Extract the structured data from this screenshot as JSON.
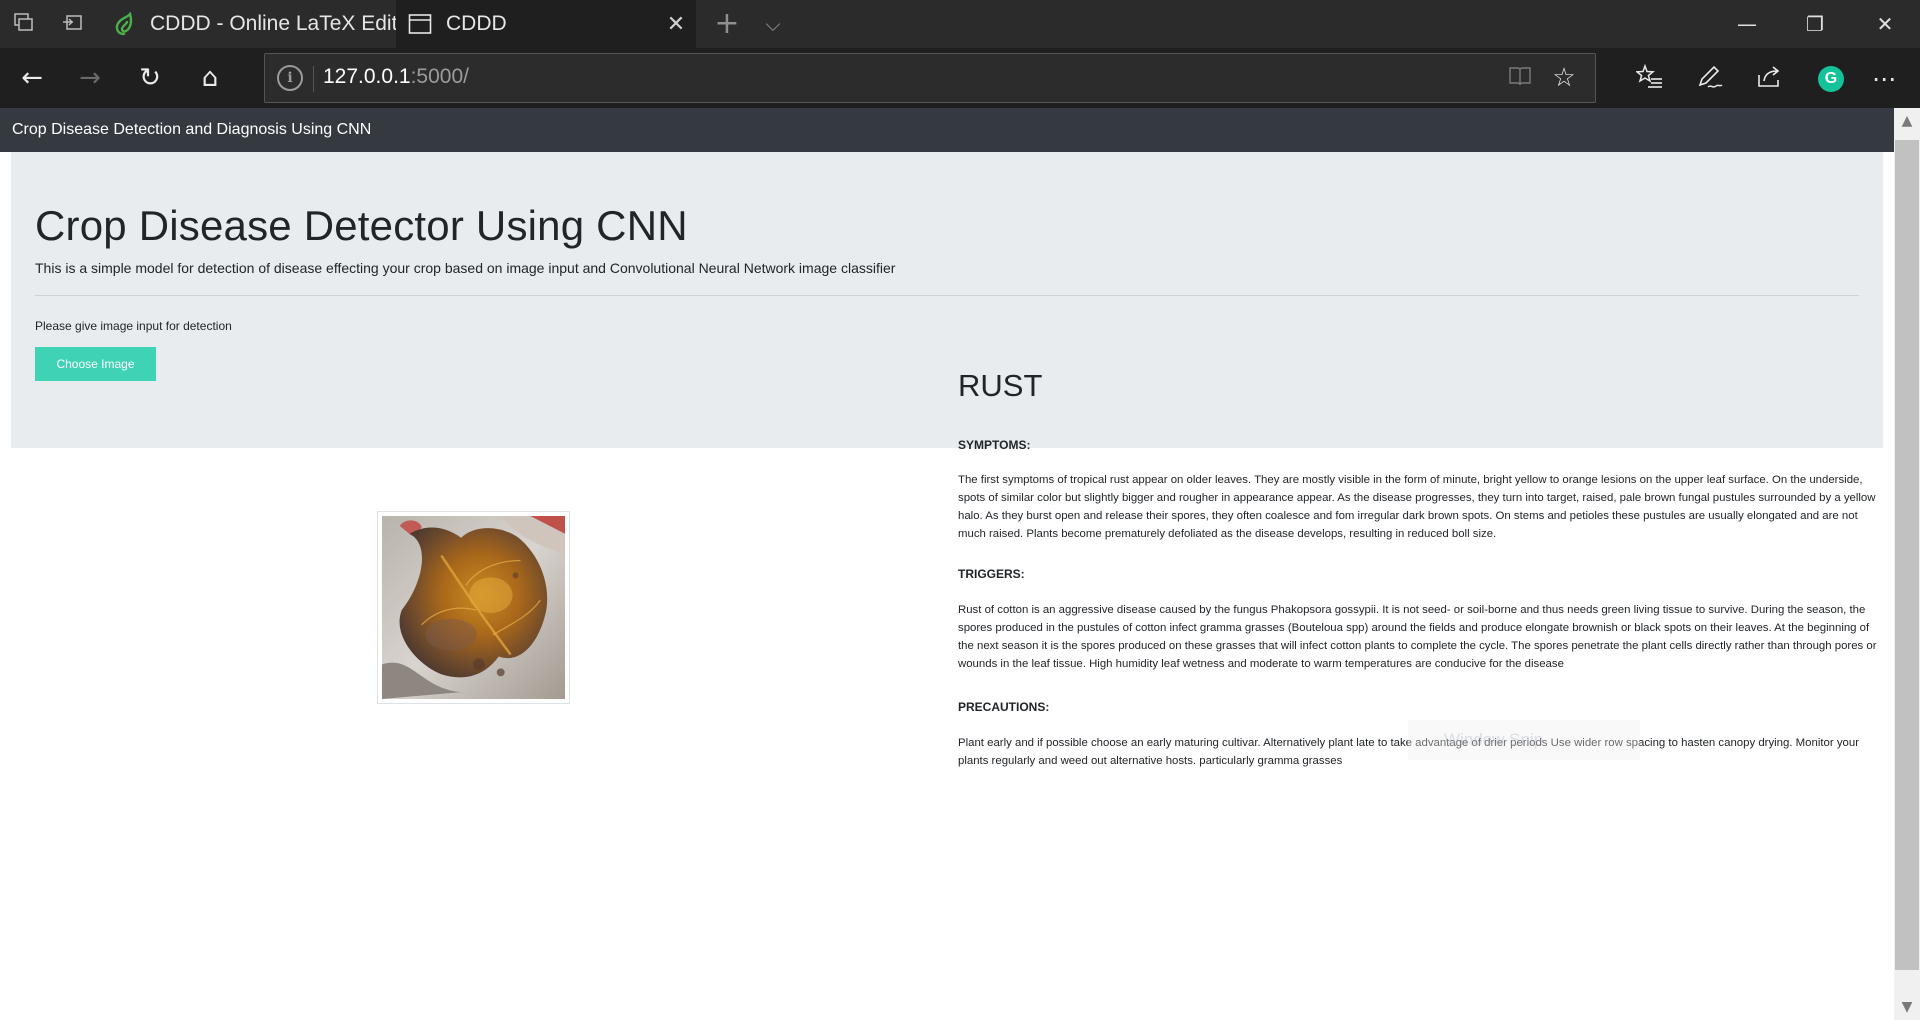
{
  "browser": {
    "tabs": [
      {
        "label": "CDDD - Online LaTeX Editor",
        "active": false
      },
      {
        "label": "CDDD",
        "active": true
      }
    ],
    "address": {
      "host": "127.0.0.1",
      "rest": ":5000/"
    },
    "icons": {
      "tab_actions": "tab-preview-icon",
      "set_aside": "set-aside-icon",
      "new_tab": "+",
      "tab_menu": "⌵",
      "back": "←",
      "forward": "→",
      "refresh": "↻",
      "home": "⌂",
      "info": "i",
      "reading": "📖",
      "favorite": "☆",
      "favorites_hub": "✩",
      "notes": "✎",
      "share": "⇪",
      "more": "⋯",
      "grammarly": "G",
      "minimize": "—",
      "restore": "❐",
      "close": "✕"
    },
    "accent_color": "#15c39a"
  },
  "site": {
    "navbar_brand": "Crop Disease Detection and Diagnosis Using CNN",
    "jumbotron": {
      "title": "Crop Disease Detector Using CNN",
      "lead": "This is a simple model for detection of disease effecting your crop based on image input and Convolutional Neural Network image classifier",
      "prompt": "Please give image input for detection",
      "button_label": "Choose Image",
      "button_color": "#3fd2b4"
    },
    "result": {
      "disease": "RUST",
      "sections": [
        {
          "heading": "SYMPTOMS:",
          "body": "The first symptoms of tropical rust appear on older leaves. They are mostly visible in the form of minute, bright yellow to orange lesions on the upper leaf surface. On the underside, spots of similar color but slightly bigger and rougher in appearance appear. As the disease progresses, they turn into target, raised, pale brown fungal pustules surrounded by a yellow halo. As they burst open and release their spores, they often coalesce and fom irregular dark brown spots. On stems and petioles these pustules are usually elongated and are not much raised. Plants become prematurely defoliated as the disease develops, resulting in reduced boll size."
        },
        {
          "heading": "TRIGGERS:",
          "body": "Rust of cotton is an aggressive disease caused by the fungus Phakopsora gossypii. It is not seed- or soil-borne and thus needs green living tissue to survive. During the season, the spores produced in the pustules of cotton infect gramma grasses (Bouteloua spp) around the fields and produce elongate brownish or black spots on their leaves. At the beginning of the next season it is the spores produced on these grasses that will infect cotton plants to complete the cycle. The spores penetrate the plant cells directly rather than through pores or wounds in the leaf tissue. High humidity leaf wetness and moderate to warm temperatures are conducive for the disease"
        },
        {
          "heading": "PRECAUTIONS:",
          "body": "Plant early and if possible choose an early maturing cultivar. Alternatively plant late to take advantage of drier periods Use wider row spacing to hasten canopy drying. Monitor your plants regularly and weed out alternative hosts. particularly gramma grasses"
        }
      ]
    },
    "watermark": "Window Snip"
  },
  "scrollbar": {
    "up": "▲",
    "down": "▼"
  }
}
